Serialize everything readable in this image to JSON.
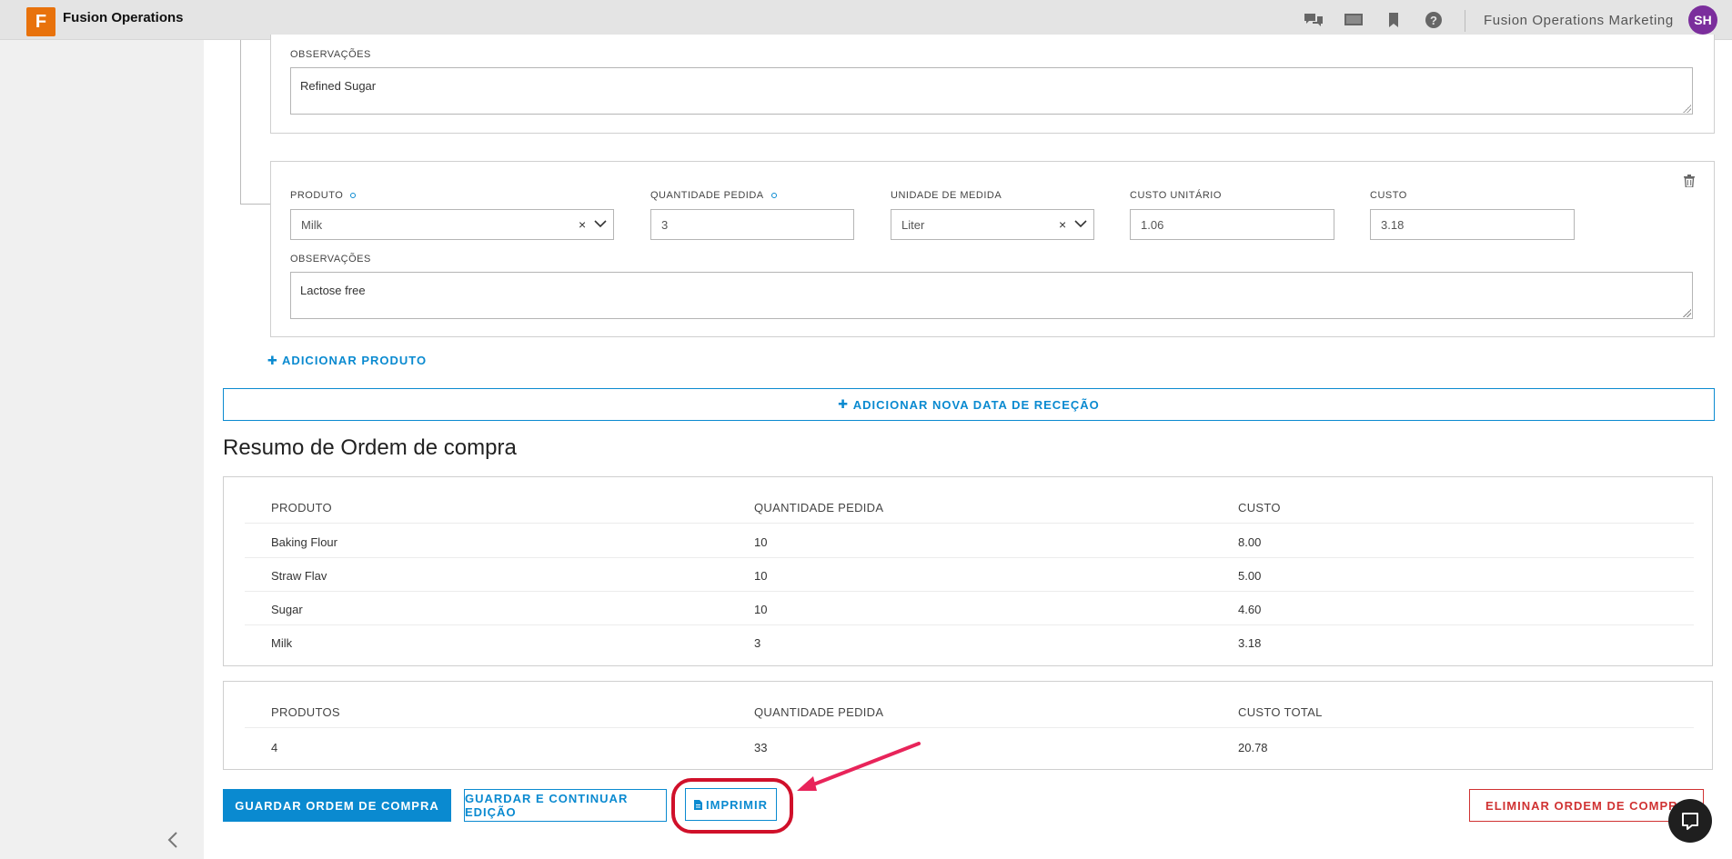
{
  "app": {
    "logo_letter": "F",
    "title": "Fusion Operations",
    "org_name": "Fusion Operations Marketing",
    "avatar_initials": "SH"
  },
  "topbar_icons": [
    "chat-icon",
    "presentation-icon",
    "bookmark-icon",
    "help-icon"
  ],
  "product_block_1": {
    "observations_label": "OBSERVAÇÕES",
    "observations_value": "Refined Sugar"
  },
  "product_block_2": {
    "product_label": "PRODUTO",
    "product_value": "Milk",
    "qty_label": "QUANTIDADE PEDIDA",
    "qty_value": "3",
    "unit_label": "UNIDADE DE MEDIDA",
    "unit_value": "Liter",
    "unit_cost_label": "CUSTO UNITÁRIO",
    "unit_cost_value": "1.06",
    "cost_label": "CUSTO",
    "cost_value": "3.18",
    "observations_label": "OBSERVAÇÕES",
    "observations_value": "Lactose free"
  },
  "actions": {
    "add_product": "ADICIONAR PRODUTO",
    "add_reception_date": "ADICIONAR NOVA DATA DE RECEÇÃO"
  },
  "summary": {
    "title": "Resumo de Ordem de compra",
    "columns": [
      "PRODUTO",
      "QUANTIDADE PEDIDA",
      "CUSTO"
    ],
    "rows": [
      [
        "Baking Flour",
        "10",
        "8.00"
      ],
      [
        "Straw Flav",
        "10",
        "5.00"
      ],
      [
        "Sugar",
        "10",
        "4.60"
      ],
      [
        "Milk",
        "3",
        "3.18"
      ]
    ]
  },
  "totals": {
    "columns": [
      "PRODUTOS",
      "QUANTIDADE PEDIDA",
      "CUSTO TOTAL"
    ],
    "values": [
      "4",
      "33",
      "20.78"
    ]
  },
  "buttons": {
    "save": "GUARDAR ORDEM DE COMPRA",
    "save_continue": "GUARDAR E CONTINUAR EDIÇÃO",
    "print": "IMPRIMIR",
    "delete": "ELIMINAR ORDEM DE COMPRA"
  },
  "colors": {
    "accent": "#0a8ad0",
    "danger": "#d03232",
    "annotation": "#e8245a",
    "highlight_ring": "#d0102a"
  }
}
